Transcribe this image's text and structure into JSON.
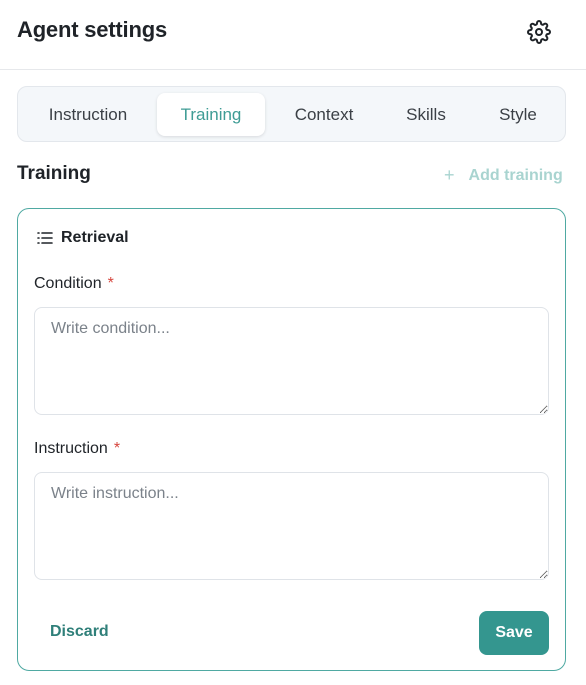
{
  "header": {
    "title": "Agent settings",
    "settings_icon": "gear-icon"
  },
  "tabs": [
    {
      "label": "Instruction",
      "active": false
    },
    {
      "label": "Training",
      "active": true
    },
    {
      "label": "Context",
      "active": false
    },
    {
      "label": "Skills",
      "active": false
    },
    {
      "label": "Style",
      "active": false
    }
  ],
  "section": {
    "title": "Training",
    "add_label": "Add training",
    "add_icon": "plus-icon"
  },
  "card": {
    "title": "Retrieval",
    "title_icon": "list-icon",
    "condition": {
      "label": "Condition",
      "required_mark": "*",
      "placeholder": "Write condition...",
      "value": ""
    },
    "instruction": {
      "label": "Instruction",
      "required_mark": "*",
      "placeholder": "Write instruction...",
      "value": ""
    },
    "discard_label": "Discard",
    "save_label": "Save"
  },
  "colors": {
    "accent": "#34968f",
    "accent_light": "#a9d4d0",
    "required": "#d6453d"
  }
}
